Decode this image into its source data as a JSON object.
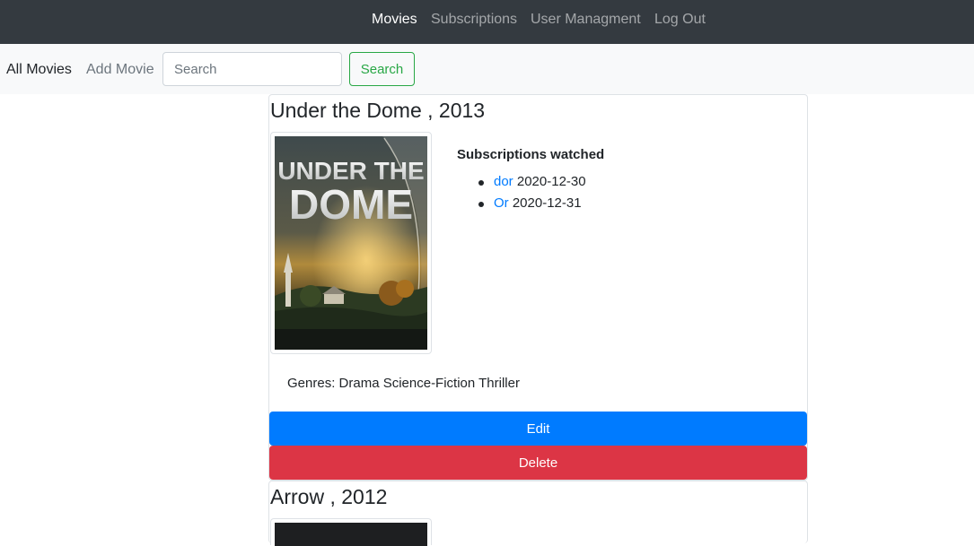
{
  "nav": {
    "items": [
      {
        "label": "Movies",
        "active": true
      },
      {
        "label": "Subscriptions",
        "active": false
      },
      {
        "label": "User Managment",
        "active": false
      },
      {
        "label": "Log Out",
        "active": false
      }
    ]
  },
  "subnav": {
    "all_movies": "All Movies",
    "add_movie": "Add Movie",
    "search_placeholder": "Search",
    "search_button": "Search"
  },
  "movies": [
    {
      "title": "Under the Dome , 2013",
      "poster_text": [
        "UNDER THE",
        "DOME"
      ],
      "subscriptions_heading": "Subscriptions watched",
      "subscriptions": [
        {
          "name": "dor",
          "date": "2020-12-30"
        },
        {
          "name": "Or",
          "date": "2020-12-31"
        }
      ],
      "genres": "Genres: Drama Science-Fiction Thriller",
      "edit_label": "Edit",
      "delete_label": "Delete"
    },
    {
      "title": "Arrow , 2012"
    }
  ],
  "colors": {
    "navbar_bg": "#343a40",
    "subnav_bg": "#f8f9fa",
    "link": "#007bff",
    "success": "#28a745",
    "primary": "#007bff",
    "danger": "#dc3545"
  }
}
